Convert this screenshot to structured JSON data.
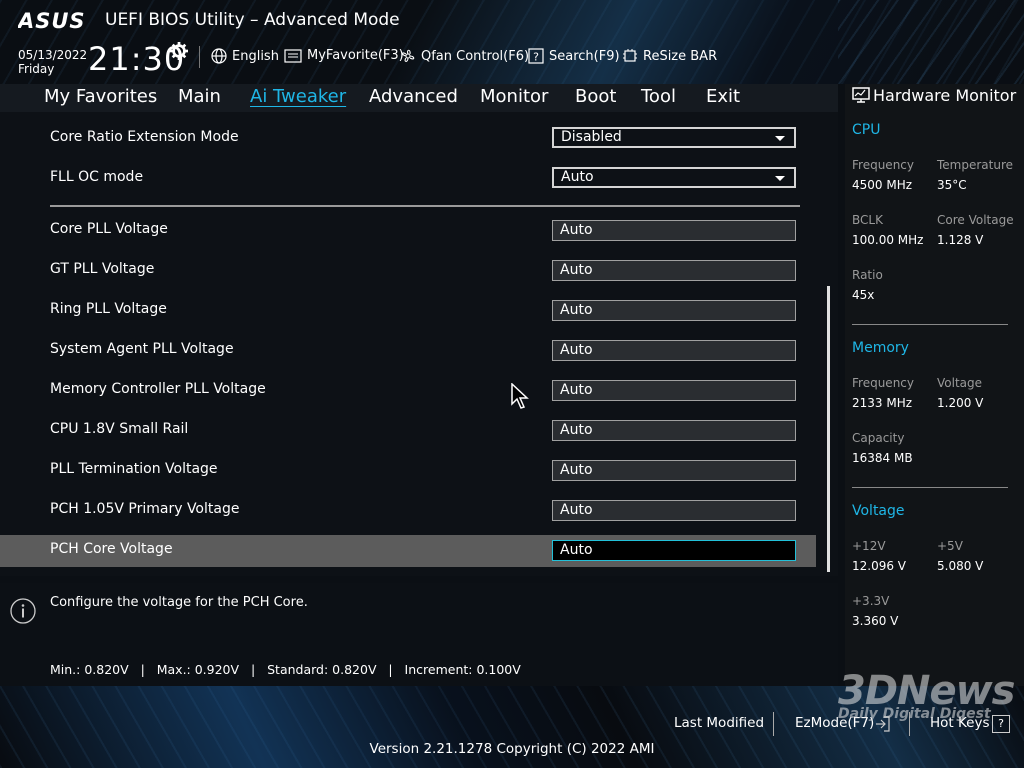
{
  "header": {
    "brand": "ASUS",
    "title": "UEFI BIOS Utility – Advanced Mode",
    "date": "05/13/2022",
    "day": "Friday",
    "time": "21:30",
    "items": [
      {
        "label": "English",
        "icon": "globe-icon"
      },
      {
        "label": "MyFavorite(F3)",
        "icon": "favorite-icon"
      },
      {
        "label": "Qfan Control(F6)",
        "icon": "fan-icon"
      },
      {
        "label": "Search(F9)",
        "icon": "search-question-icon"
      },
      {
        "label": "ReSize BAR",
        "icon": "chip-icon"
      }
    ]
  },
  "menu": {
    "tabs": [
      "My Favorites",
      "Main",
      "Ai Tweaker",
      "Advanced",
      "Monitor",
      "Boot",
      "Tool",
      "Exit"
    ],
    "active": "Ai Tweaker"
  },
  "settings": [
    {
      "label": "Core Ratio Extension Mode",
      "value": "Disabled",
      "type": "dropdown"
    },
    {
      "label": "FLL OC mode",
      "value": "Auto",
      "type": "dropdown"
    },
    {
      "label": "Core PLL Voltage",
      "value": "Auto",
      "type": "field"
    },
    {
      "label": "GT PLL Voltage",
      "value": "Auto",
      "type": "field"
    },
    {
      "label": "Ring PLL Voltage",
      "value": "Auto",
      "type": "field"
    },
    {
      "label": "System Agent PLL Voltage",
      "value": "Auto",
      "type": "field"
    },
    {
      "label": "Memory Controller PLL Voltage",
      "value": "Auto",
      "type": "field"
    },
    {
      "label": "CPU 1.8V Small Rail",
      "value": "Auto",
      "type": "field"
    },
    {
      "label": "PLL Termination Voltage",
      "value": "Auto",
      "type": "field"
    },
    {
      "label": "PCH 1.05V Primary Voltage",
      "value": "Auto",
      "type": "field"
    },
    {
      "label": "PCH Core Voltage",
      "value": "Auto",
      "type": "field",
      "selected": true
    }
  ],
  "help": {
    "description": "Configure the voltage for the PCH Core.",
    "specs": "Min.: 0.820V   |   Max.: 0.920V   |   Standard: 0.820V   |   Increment: 0.100V"
  },
  "hardware_monitor": {
    "title": "Hardware Monitor",
    "cpu": {
      "section": "CPU",
      "frequency_label": "Frequency",
      "frequency": "4500 MHz",
      "temperature_label": "Temperature",
      "temperature": "35°C",
      "bclk_label": "BCLK",
      "bclk": "100.00 MHz",
      "core_voltage_label": "Core Voltage",
      "core_voltage": "1.128 V",
      "ratio_label": "Ratio",
      "ratio": "45x"
    },
    "memory": {
      "section": "Memory",
      "frequency_label": "Frequency",
      "frequency": "2133 MHz",
      "voltage_label": "Voltage",
      "voltage": "1.200 V",
      "capacity_label": "Capacity",
      "capacity": "16384 MB"
    },
    "voltage": {
      "section": "Voltage",
      "v12_label": "+12V",
      "v12": "12.096 V",
      "v5_label": "+5V",
      "v5": "5.080 V",
      "v33_label": "+3.3V",
      "v33": "3.360 V"
    }
  },
  "footer": {
    "last_modified": "Last Modified",
    "ezmode": "EzMode(F7)",
    "hotkeys": "Hot Keys",
    "hotkeys_key": "?",
    "version": "Version 2.21.1278 Copyright (C) 2022 AMI"
  },
  "watermark": {
    "main": "3DNews",
    "sub": "Daily Digital Digest"
  },
  "colors": {
    "accent": "#1fb6e6",
    "highlight_row": "#5c5c5c",
    "panel": "#0d1116"
  }
}
